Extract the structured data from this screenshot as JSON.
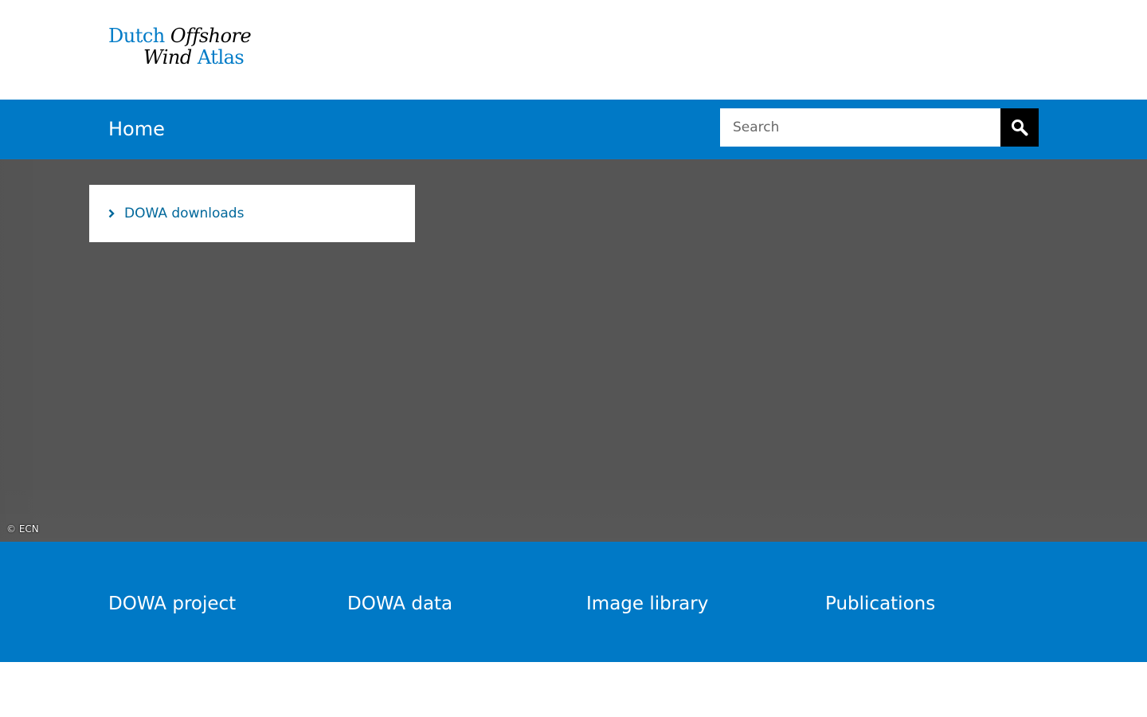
{
  "logo": {
    "line1_word1": "Dutch",
    "line1_word2": "Offshore",
    "line2_word1": "Wind",
    "line2_word2": "Atlas"
  },
  "nav": {
    "home_label": "Home"
  },
  "search": {
    "placeholder": "Search",
    "value": "",
    "button_icon": "search-icon"
  },
  "menu": {
    "items": [
      {
        "label": "DOWA downloads",
        "icon": "chevron-right-icon"
      }
    ]
  },
  "image": {
    "credit": "© ECN"
  },
  "footer": {
    "links": [
      {
        "label": "DOWA project"
      },
      {
        "label": "DOWA data"
      },
      {
        "label": "Image library"
      },
      {
        "label": "Publications"
      }
    ]
  },
  "colors": {
    "brand_blue": "#0079c6",
    "logo_blue": "#007bc7",
    "link_blue": "#01689b",
    "hero_gray": "#555555",
    "search_button": "#000000"
  }
}
